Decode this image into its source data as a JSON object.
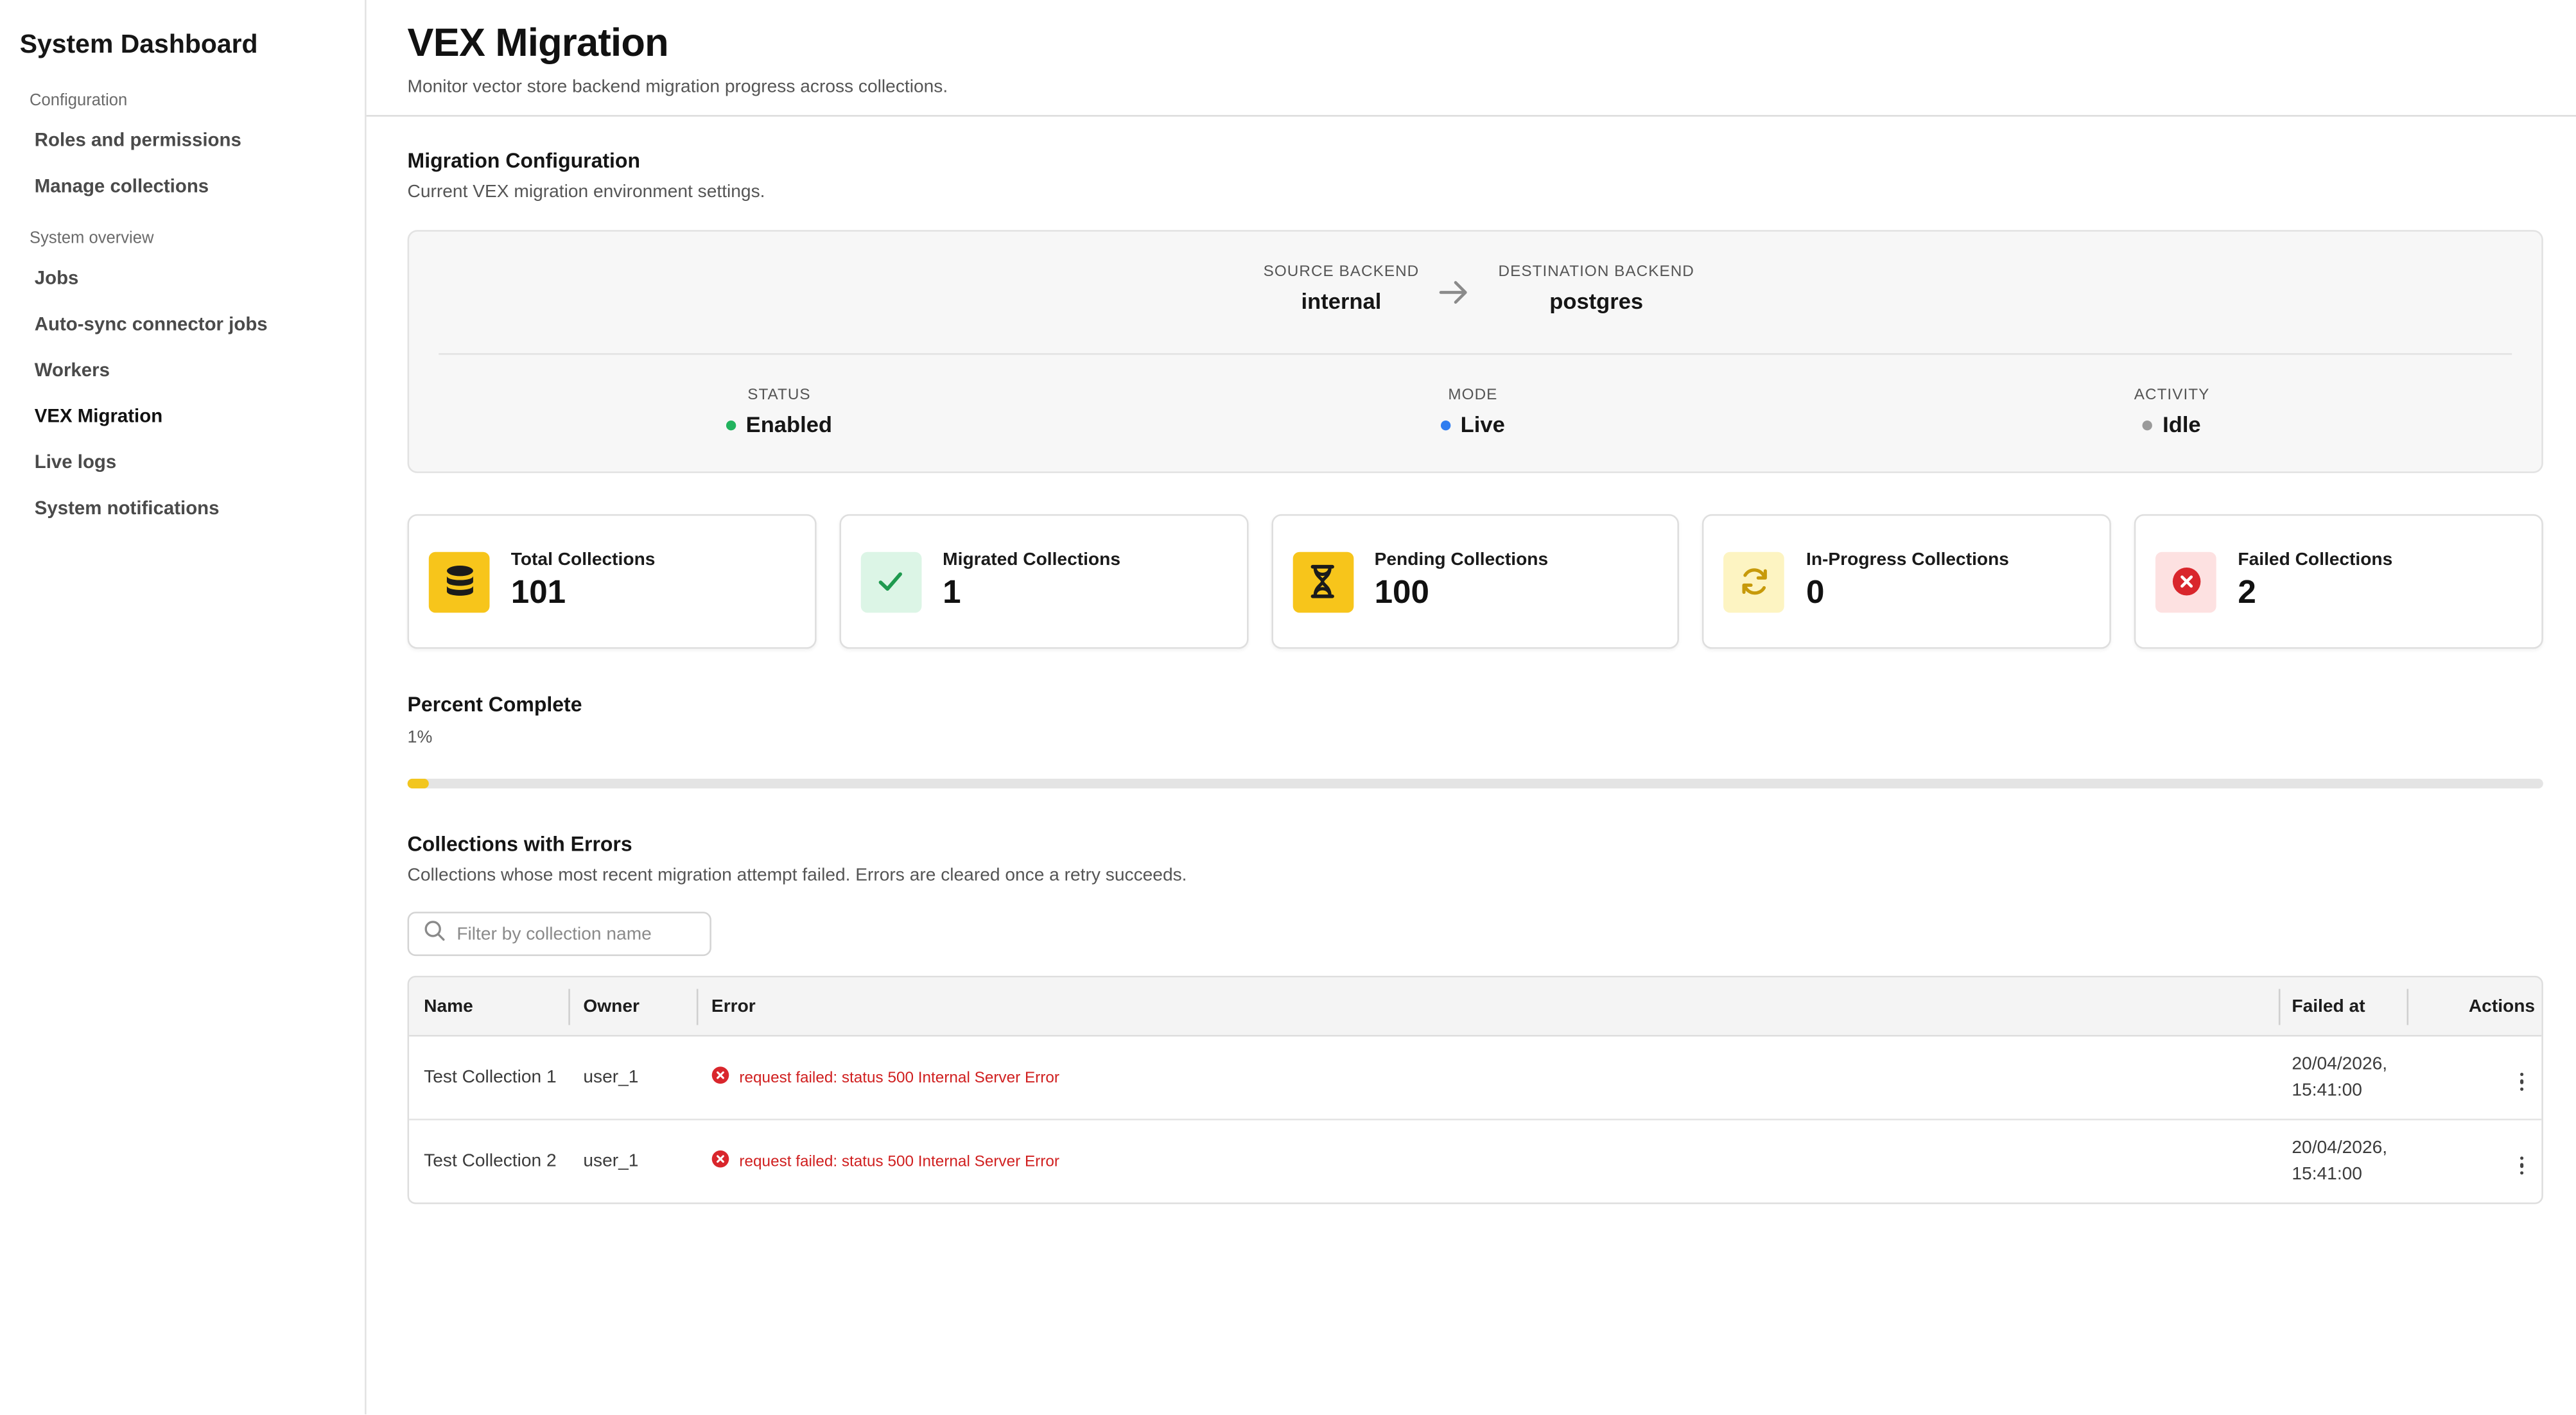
{
  "sidebar": {
    "title": "System Dashboard",
    "sections": [
      {
        "label": "Configuration",
        "items": [
          {
            "label": "Roles and permissions"
          },
          {
            "label": "Manage collections"
          }
        ]
      },
      {
        "label": "System overview",
        "items": [
          {
            "label": "Jobs"
          },
          {
            "label": "Auto-sync connector jobs"
          },
          {
            "label": "Workers"
          },
          {
            "label": "VEX Migration",
            "active": true
          },
          {
            "label": "Live logs"
          },
          {
            "label": "System notifications"
          }
        ]
      }
    ]
  },
  "header": {
    "title": "VEX Migration",
    "subtitle": "Monitor vector store backend migration progress across collections."
  },
  "config": {
    "title": "Migration Configuration",
    "subtitle": "Current VEX migration environment settings.",
    "source_label": "SOURCE BACKEND",
    "source_value": "internal",
    "destination_label": "DESTINATION BACKEND",
    "destination_value": "postgres",
    "status_label": "STATUS",
    "status_value": "Enabled",
    "status_color": "#22b35e",
    "mode_label": "MODE",
    "mode_value": "Live",
    "mode_color": "#2f7df0",
    "activity_label": "ACTIVITY",
    "activity_value": "Idle",
    "activity_color": "#9a9a9a"
  },
  "cards": [
    {
      "label": "Total Collections",
      "value": "101",
      "icon": "database-icon",
      "icon_bg": "#f7c51b"
    },
    {
      "label": "Migrated Collections",
      "value": "1",
      "icon": "check-icon",
      "icon_bg": "#dcf5e6"
    },
    {
      "label": "Pending Collections",
      "value": "100",
      "icon": "hourglass-icon",
      "icon_bg": "#f7c51b"
    },
    {
      "label": "In-Progress Collections",
      "value": "0",
      "icon": "refresh-icon",
      "icon_bg": "#fdf4c2"
    },
    {
      "label": "Failed Collections",
      "value": "2",
      "icon": "x-circle-icon",
      "icon_bg": "#fde1e1"
    }
  ],
  "progress": {
    "title": "Percent Complete",
    "value_text": "1%",
    "fraction": 0.01,
    "accent": "#f2c61f"
  },
  "errors": {
    "title": "Collections with Errors",
    "subtitle": "Collections whose most recent migration attempt failed. Errors are cleared once a retry succeeds.",
    "filter_placeholder": "Filter by collection name",
    "columns": [
      "Name",
      "Owner",
      "Error",
      "Failed at",
      "Actions"
    ],
    "rows": [
      {
        "name": "Test Collection 1",
        "owner": "user_1",
        "error": "request failed: status 500 Internal Server Error",
        "failed_date": "20/04/2026,",
        "failed_time": "15:41:00"
      },
      {
        "name": "Test Collection 2",
        "owner": "user_1",
        "error": "request failed: status 500 Internal Server Error",
        "failed_date": "20/04/2026,",
        "failed_time": "15:41:00"
      }
    ]
  }
}
